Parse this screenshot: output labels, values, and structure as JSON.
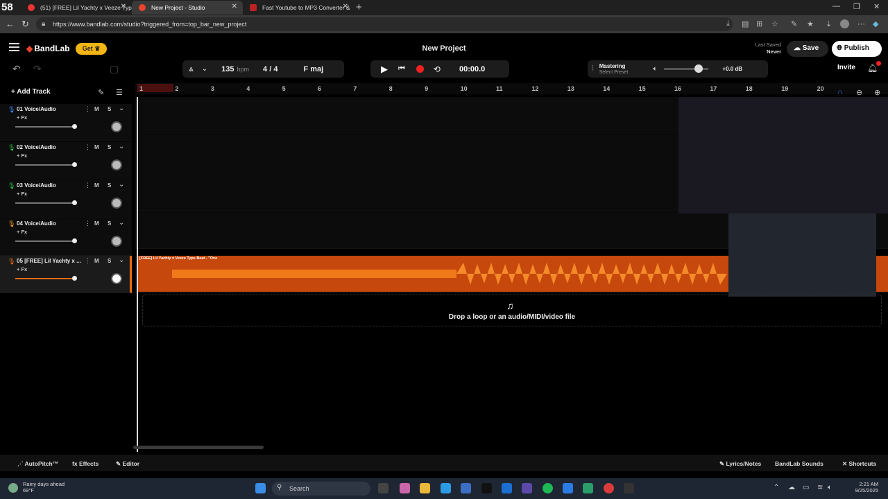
{
  "browser": {
    "badge": "58",
    "tabs": [
      {
        "title": "(51) [FREE] Lil Yachty x Veeze Typ",
        "active": false
      },
      {
        "title": "New Project - Studio",
        "active": true
      },
      {
        "title": "Fast Youtube to MP3 Converter &",
        "active": false
      }
    ],
    "url": "https://www.bandlab.com/studio?triggered_from=top_bar_new_project"
  },
  "app": {
    "logo": "BandLab",
    "get_label": "Get",
    "title": "New Project",
    "last_saved_label": "Last Saved",
    "last_saved_value": "Never",
    "save_label": "Save",
    "publish_label": "Publish",
    "invite_label": "Invite"
  },
  "toolbar": {
    "bpm": "135",
    "bpm_unit": "bpm",
    "time_signature": "4 / 4",
    "key": "F maj",
    "time": "00:00.0",
    "mastering_label": "Mastering",
    "mastering_preset": "Select Preset",
    "volume_db": "+0.0 dB",
    "master_volume_level": 0.78
  },
  "tracks_panel": {
    "add_track_label": "Add Track",
    "tracks": [
      {
        "name": "01 Voice/Audio",
        "fx": "+ Fx",
        "m": "M",
        "s": "S",
        "color": "#3f86ff"
      },
      {
        "name": "02 Voice/Audio",
        "fx": "+ Fx",
        "m": "M",
        "s": "S",
        "color": "#2fbf4f"
      },
      {
        "name": "03 Voice/Audio",
        "fx": "+ Fx",
        "m": "M",
        "s": "S",
        "color": "#2fbf4f"
      },
      {
        "name": "04 Voice/Audio",
        "fx": "+ Fx",
        "m": "M",
        "s": "S",
        "color": "#f0a020"
      },
      {
        "name": "05 [FREE] Lil Yachty x ...",
        "fx": "+ Fx",
        "m": "M",
        "s": "S",
        "color": "#f06a10"
      }
    ]
  },
  "ruler": {
    "bars": [
      "1",
      "2",
      "3",
      "4",
      "5",
      "6",
      "7",
      "8",
      "9",
      "10",
      "11",
      "12",
      "13",
      "14",
      "15",
      "16",
      "17",
      "18",
      "19",
      "20"
    ]
  },
  "clip": {
    "name": "[FREE] Lil Yachty x Veeze Type Beat - \"Ove"
  },
  "dropzone": {
    "text": "Drop a loop or an audio/MIDI/video file"
  },
  "bottom": {
    "autopitch": "AutoPitch™",
    "effects": "Effects",
    "editor": "Editor",
    "lyrics": "Lyrics/Notes",
    "sounds": "BandLab Sounds",
    "shortcuts": "Shortcuts"
  },
  "taskbar": {
    "weather_title": "Rainy days ahead",
    "weather_temp": "69°F",
    "search": "Search",
    "time": "2:21 AM",
    "date": "9/25/2025"
  }
}
